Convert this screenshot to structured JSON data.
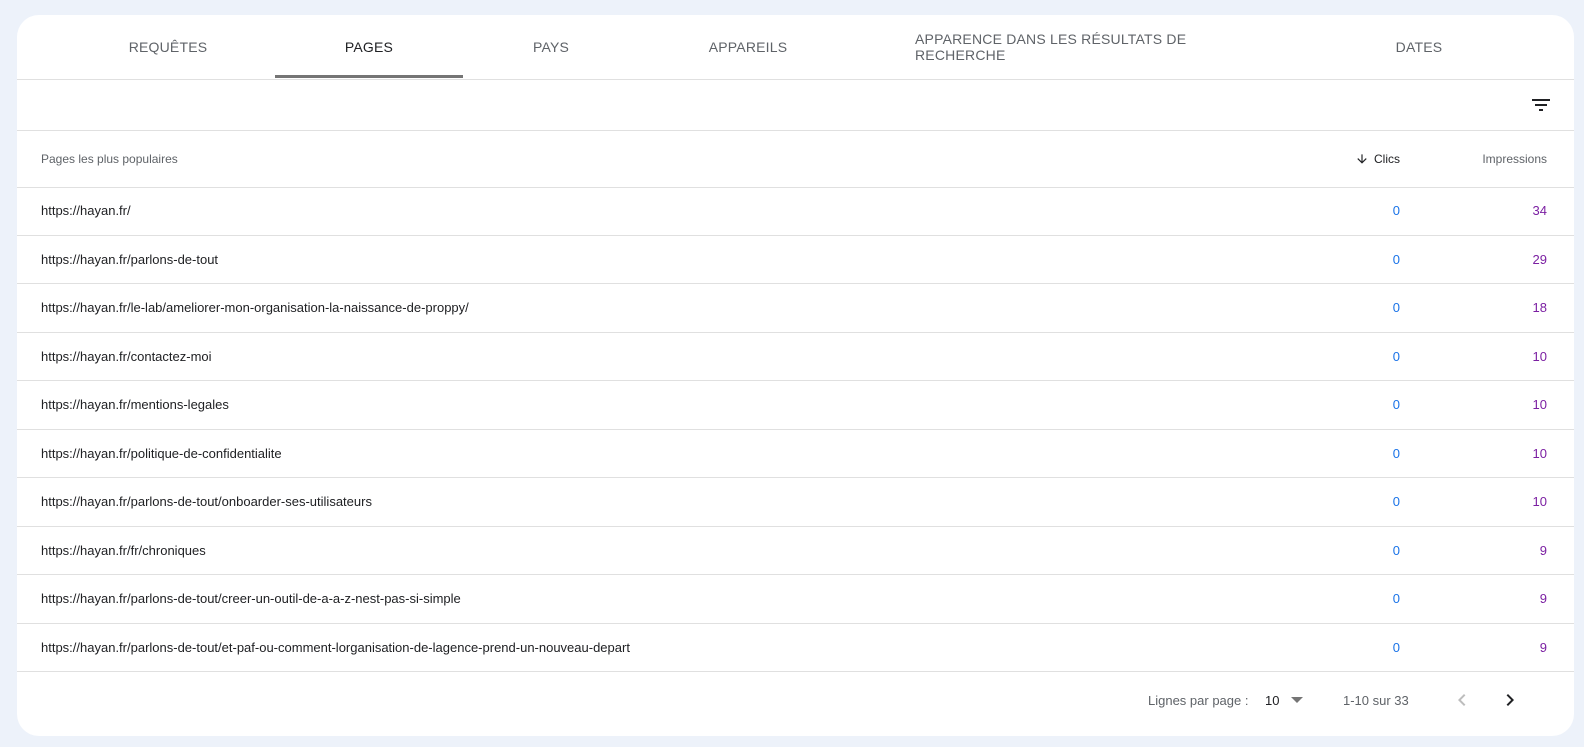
{
  "tabs": [
    {
      "label": "REQUÊTES",
      "active": false
    },
    {
      "label": "PAGES",
      "active": true
    },
    {
      "label": "PAYS",
      "active": false
    },
    {
      "label": "APPAREILS",
      "active": false
    },
    {
      "label": "APPARENCE DANS LES RÉSULTATS DE RECHERCHE",
      "active": false
    },
    {
      "label": "DATES",
      "active": false
    }
  ],
  "toolbar": {
    "filter_icon": "filter-list-icon"
  },
  "table": {
    "headers": {
      "pages": "Pages les plus populaires",
      "clics": "Clics",
      "impressions": "Impressions",
      "sort_icon": "arrow-down-icon"
    },
    "rows": [
      {
        "url": "https://hayan.fr/",
        "clics": "0",
        "impressions": "34"
      },
      {
        "url": "https://hayan.fr/parlons-de-tout",
        "clics": "0",
        "impressions": "29"
      },
      {
        "url": "https://hayan.fr/le-lab/ameliorer-mon-organisation-la-naissance-de-proppy/",
        "clics": "0",
        "impressions": "18"
      },
      {
        "url": "https://hayan.fr/contactez-moi",
        "clics": "0",
        "impressions": "10"
      },
      {
        "url": "https://hayan.fr/mentions-legales",
        "clics": "0",
        "impressions": "10"
      },
      {
        "url": "https://hayan.fr/politique-de-confidentialite",
        "clics": "0",
        "impressions": "10"
      },
      {
        "url": "https://hayan.fr/parlons-de-tout/onboarder-ses-utilisateurs",
        "clics": "0",
        "impressions": "10"
      },
      {
        "url": "https://hayan.fr/fr/chroniques",
        "clics": "0",
        "impressions": "9"
      },
      {
        "url": "https://hayan.fr/parlons-de-tout/creer-un-outil-de-a-a-z-nest-pas-si-simple",
        "clics": "0",
        "impressions": "9"
      },
      {
        "url": "https://hayan.fr/parlons-de-tout/et-paf-ou-comment-lorganisation-de-lagence-prend-un-nouveau-depart",
        "clics": "0",
        "impressions": "9"
      }
    ]
  },
  "pagination": {
    "rows_label": "Lignes par page :",
    "rows_value": "10",
    "range": "1-10 sur 33",
    "prev_icon": "chevron-left-icon",
    "next_icon": "chevron-right-icon"
  },
  "colors": {
    "clics": "#1a73e8",
    "impressions": "#7b1fa2",
    "background": "#edf2fa"
  }
}
